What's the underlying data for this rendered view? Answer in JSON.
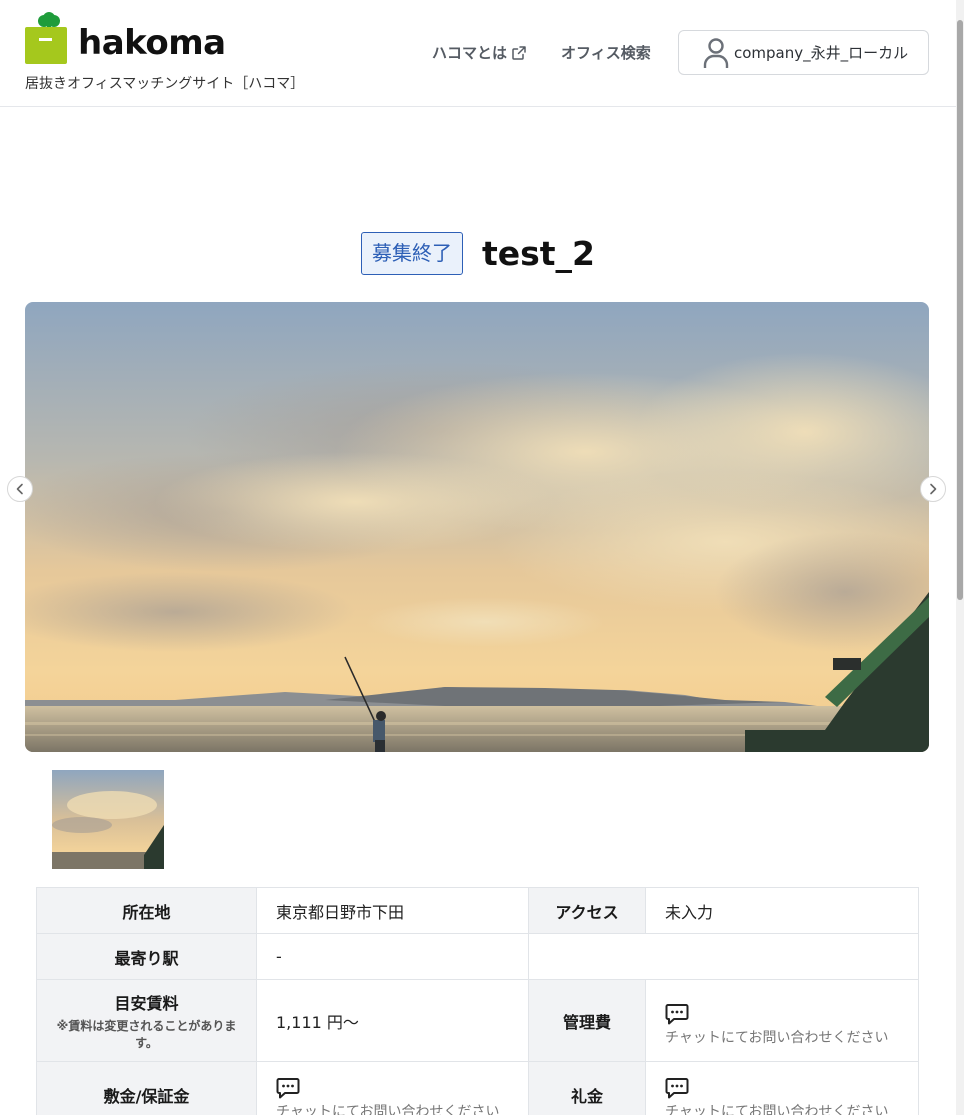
{
  "header": {
    "logo_text": "hakoma",
    "tagline": "居抜きオフィスマッチングサイト［ハコマ］",
    "nav": {
      "about_label": "ハコマとは",
      "search_label": "オフィス検索"
    },
    "user_label": "company_永井_ローカル"
  },
  "listing": {
    "status": "募集終了",
    "title": "test_2"
  },
  "details": {
    "location": {
      "label": "所在地",
      "value": "東京都日野市下田"
    },
    "access": {
      "label": "アクセス",
      "value": "未入力"
    },
    "station": {
      "label": "最寄り駅",
      "value": "-"
    },
    "rent": {
      "label": "目安賃料",
      "note": "※賃料は変更されることがあります。",
      "value": "1,111 円〜"
    },
    "management_fee": {
      "label": "管理費",
      "value": "チャットにてお問い合わせください"
    },
    "deposit": {
      "label": "敷金/保証金",
      "value": "チャットにてお問い合わせください"
    },
    "key_money": {
      "label": "礼金",
      "value": "チャットにてお問い合わせください"
    }
  },
  "icons": [
    "external-link-icon",
    "user-icon",
    "chevron-left-icon",
    "chevron-right-icon",
    "chat-icon"
  ],
  "colors": {
    "brand_green": "#a5c81d",
    "status_blue": "#2d5fb6",
    "table_header_bg": "#f2f3f5"
  }
}
